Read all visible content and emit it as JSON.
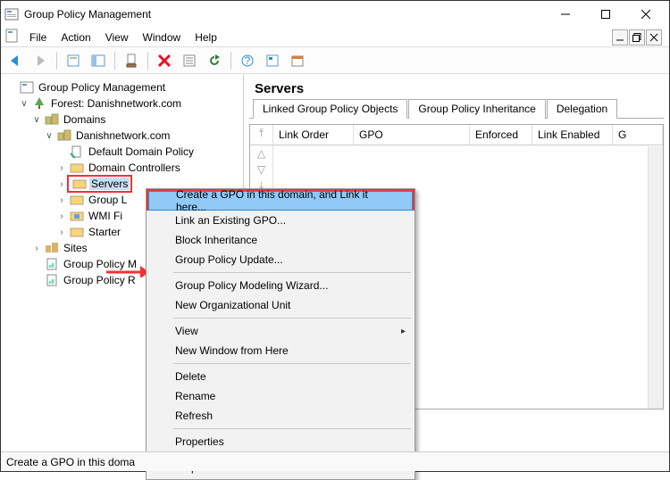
{
  "window": {
    "title": "Group Policy Management"
  },
  "menubar": {
    "items": [
      "File",
      "Action",
      "View",
      "Window",
      "Help"
    ]
  },
  "tree": {
    "root": "Group Policy Management",
    "forest": "Forest: Danishnetwork.com",
    "domains": "Domains",
    "domain": "Danishnetwork.com",
    "items": {
      "default_policy": "Default Domain Policy",
      "domain_controllers": "Domain Controllers",
      "servers": "Servers",
      "group_l": "Group L",
      "wmi_fi": "WMI Fi",
      "starter": "Starter",
      "sites": "Sites",
      "gp_m": "Group Policy M",
      "gp_r": "Group Policy R"
    }
  },
  "contextmenu": {
    "items": [
      "Create a GPO in this domain, and Link it here...",
      "Link an Existing GPO...",
      "Block Inheritance",
      "Group Policy Update...",
      "Group Policy Modeling Wizard...",
      "New Organizational Unit",
      "View",
      "New Window from Here",
      "Delete",
      "Rename",
      "Refresh",
      "Properties",
      "Help"
    ]
  },
  "detail": {
    "heading": "Servers",
    "tabs": [
      "Linked Group Policy Objects",
      "Group Policy Inheritance",
      "Delegation"
    ],
    "columns": [
      "Link Order",
      "GPO",
      "Enforced",
      "Link Enabled",
      "G"
    ]
  },
  "status": {
    "text": "Create a GPO in this doma"
  }
}
